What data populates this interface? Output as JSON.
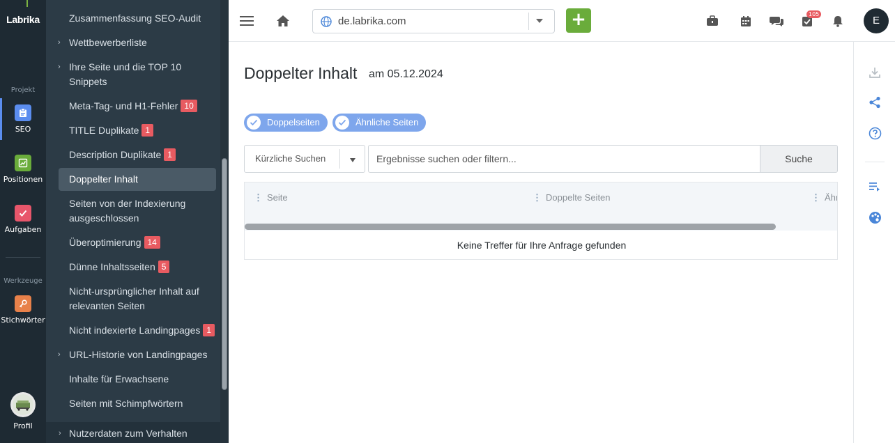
{
  "app": {
    "logo": "Labrika",
    "rail": {
      "section_project": "Projekt",
      "section_tools": "Werkzeuge",
      "items": [
        {
          "label": "SEO",
          "icon": "clipboard-icon",
          "color": "#5b8def"
        },
        {
          "label": "Positionen",
          "icon": "chart-icon",
          "color": "#6aac3b"
        },
        {
          "label": "Aufgaben",
          "icon": "check-icon",
          "color": "#e8566b"
        },
        {
          "label": "Stichwörter",
          "icon": "key-icon",
          "color": "#e8814a"
        }
      ],
      "profile_label": "Profil"
    }
  },
  "subnav": {
    "items": [
      {
        "label": "Zusammenfassung SEO-Audit",
        "expandable": false,
        "badge": ""
      },
      {
        "label": "Wettbewerberliste",
        "expandable": true,
        "badge": ""
      },
      {
        "label": "Ihre Seite und die TOP 10 Snippets",
        "expandable": true,
        "badge": ""
      },
      {
        "label": "Meta-Tag- und H1-Fehler",
        "expandable": false,
        "badge": "10"
      },
      {
        "label": "TITLE Duplikate",
        "expandable": false,
        "badge": "1"
      },
      {
        "label": "Description Duplikate",
        "expandable": false,
        "badge": "1"
      },
      {
        "label": "Doppelter Inhalt",
        "expandable": false,
        "badge": "",
        "active": true
      },
      {
        "label": "Seiten von der Indexierung ausgeschlossen",
        "expandable": false,
        "badge": ""
      },
      {
        "label": "Überoptimierung",
        "expandable": false,
        "badge": "14"
      },
      {
        "label": "Dünne Inhaltsseiten",
        "expandable": false,
        "badge": "5"
      },
      {
        "label": "Nicht-ursprünglicher Inhalt auf relevanten Seiten",
        "expandable": false,
        "badge": ""
      },
      {
        "label": "Nicht indexierte Landingpages",
        "expandable": false,
        "badge": "1"
      },
      {
        "label": "URL-Historie von Landingpages",
        "expandable": true,
        "badge": ""
      },
      {
        "label": "Inhalte für Erwachsene",
        "expandable": false,
        "badge": ""
      },
      {
        "label": "Seiten mit Schimpfwörtern",
        "expandable": false,
        "badge": ""
      }
    ],
    "footer": "Nutzerdaten zum Verhalten"
  },
  "topbar": {
    "domain": "de.labrika.com",
    "add_label": "+",
    "notification_count": "105",
    "user_initial": "E",
    "icons": [
      "menu-icon",
      "home-icon",
      "briefcase-icon",
      "calendar-icon",
      "chat-icon",
      "tasks-icon",
      "bell-icon"
    ]
  },
  "page": {
    "title": "Doppelter Inhalt",
    "date_label": "am 05.12.2024",
    "filters": [
      {
        "label": "Doppelseiten",
        "checked": true
      },
      {
        "label": "Ähnliche Seiten",
        "checked": true
      }
    ],
    "recent_search": "Kürzliche Suchen",
    "search_placeholder": "Ergebnisse suchen oder filtern...",
    "search_button": "Suche",
    "columns": [
      "Seite",
      "Doppelte Seiten",
      "Ähn"
    ],
    "empty_message": "Keine Treffer für Ihre Anfrage gefunden"
  },
  "colors": {
    "rail_bg": "#1e2a33",
    "subnav_bg": "#2c3b46",
    "accent_green": "#6aac3b",
    "chip_blue": "#7ea6ec",
    "badge_red": "#e85b61",
    "icon_blue": "#4a86d8"
  }
}
